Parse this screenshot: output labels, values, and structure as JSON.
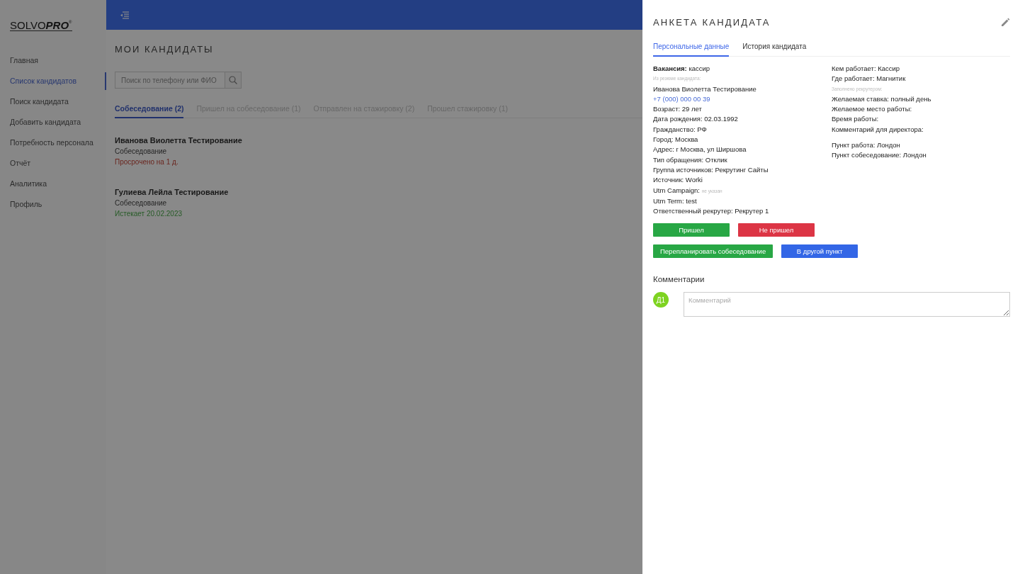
{
  "sidebar": {
    "logo": {
      "part_1": "SOLVO",
      "part_2": "PRO",
      "mark": "®"
    },
    "items": [
      {
        "label": "Главная",
        "selected": false
      },
      {
        "label": "Список кандидатов",
        "selected": true
      },
      {
        "label": "Поиск кандидата",
        "selected": false
      },
      {
        "label": "Добавить кандидата",
        "selected": false
      },
      {
        "label": "Потребность персонала",
        "selected": false
      },
      {
        "label": "Отчёт",
        "selected": false
      },
      {
        "label": "Аналитика",
        "selected": false
      },
      {
        "label": "Профиль",
        "selected": false
      }
    ]
  },
  "main": {
    "title": "МОИ КАНДИДАТЫ",
    "search": {
      "placeholder": "Поиск по телефону или ФИО"
    },
    "tabs": [
      {
        "label": "Собеседование (2)",
        "selected": true
      },
      {
        "label": "Пришел на собеседование (1)",
        "selected": false
      },
      {
        "label": "Отправлен на стажировку (2)",
        "selected": false
      },
      {
        "label": "Прошел стажировку (1)",
        "selected": false
      }
    ],
    "candidates": [
      {
        "name": "Иванова Виолетта Тестирование",
        "stage": "Собеседование",
        "deadline": "Просрочено на 1 д.",
        "overdue": true
      },
      {
        "name": "Гулиева Лейла Тестирование",
        "stage": "Собеседование",
        "deadline": "Истекает 20.02.2023",
        "overdue": false
      }
    ]
  },
  "drawer": {
    "title": "АНКЕТА КАНДИДАТА",
    "tabs": [
      {
        "label": "Персональные данные",
        "selected": true
      },
      {
        "label": "История кандидата",
        "selected": false
      }
    ],
    "left": [
      {
        "kind": "line",
        "text": "**Вакансия:** кассир"
      },
      {
        "kind": "caption",
        "text": "Из резюме кандидата:"
      },
      {
        "kind": "line",
        "text": "Иванова Виолетта Тестирование"
      },
      {
        "kind": "link",
        "text": "+7 (000) 000 00 39"
      },
      {
        "kind": "line",
        "text": "Возраст: 29 лет"
      },
      {
        "kind": "line",
        "text": "Дата рождения: 02.03.1992"
      },
      {
        "kind": "line",
        "text": "Гражданство: РФ"
      },
      {
        "kind": "line",
        "text": "Город: Москва"
      },
      {
        "kind": "line",
        "text": "Адрес: г Москва, ул Ширшова"
      },
      {
        "kind": "line",
        "text": "Тип обращения: Отклик"
      },
      {
        "kind": "line",
        "text": "Группа источников: Рекрутинг Сайты"
      },
      {
        "kind": "line",
        "text": "Источник: Worki"
      },
      {
        "kind": "unset",
        "label": "Utm Campaign:",
        "value": "не указан"
      },
      {
        "kind": "line",
        "text": "Utm Term: test"
      },
      {
        "kind": "line",
        "text": "Ответственный рекрутер: Рекрутер 1"
      }
    ],
    "right_groups": [
      [
        {
          "kind": "line",
          "text": "Кем работает: Кассир"
        },
        {
          "kind": "line",
          "text": "Где работает: Магнитик"
        },
        {
          "kind": "caption",
          "text": "Заполнено рекрутером:"
        },
        {
          "kind": "line",
          "text": "Желаемая ставка: полный день"
        },
        {
          "kind": "line",
          "text": "Желаемое место работы:"
        },
        {
          "kind": "line",
          "text": "Время работы:"
        },
        {
          "kind": "line",
          "text": "Комментарий для директора:"
        }
      ],
      [
        {
          "kind": "line",
          "text": "Пункт работа: Лондон"
        },
        {
          "kind": "line",
          "text": "Пункт собеседование: Лондон"
        }
      ]
    ],
    "button_rows": [
      [
        {
          "label": "Пришел",
          "color": "#28a745"
        },
        {
          "label": "Не пришел",
          "color": "#dc3545"
        }
      ],
      [
        {
          "label": "Перепланировать собеседование",
          "color": "#28a745"
        },
        {
          "label": "В другой пункт",
          "color": "#3366e6"
        }
      ]
    ],
    "comments": {
      "title": "Комментарии",
      "avatar": {
        "initials": "Д1",
        "color": "#7ed321"
      },
      "placeholder": "Комментарий"
    }
  }
}
